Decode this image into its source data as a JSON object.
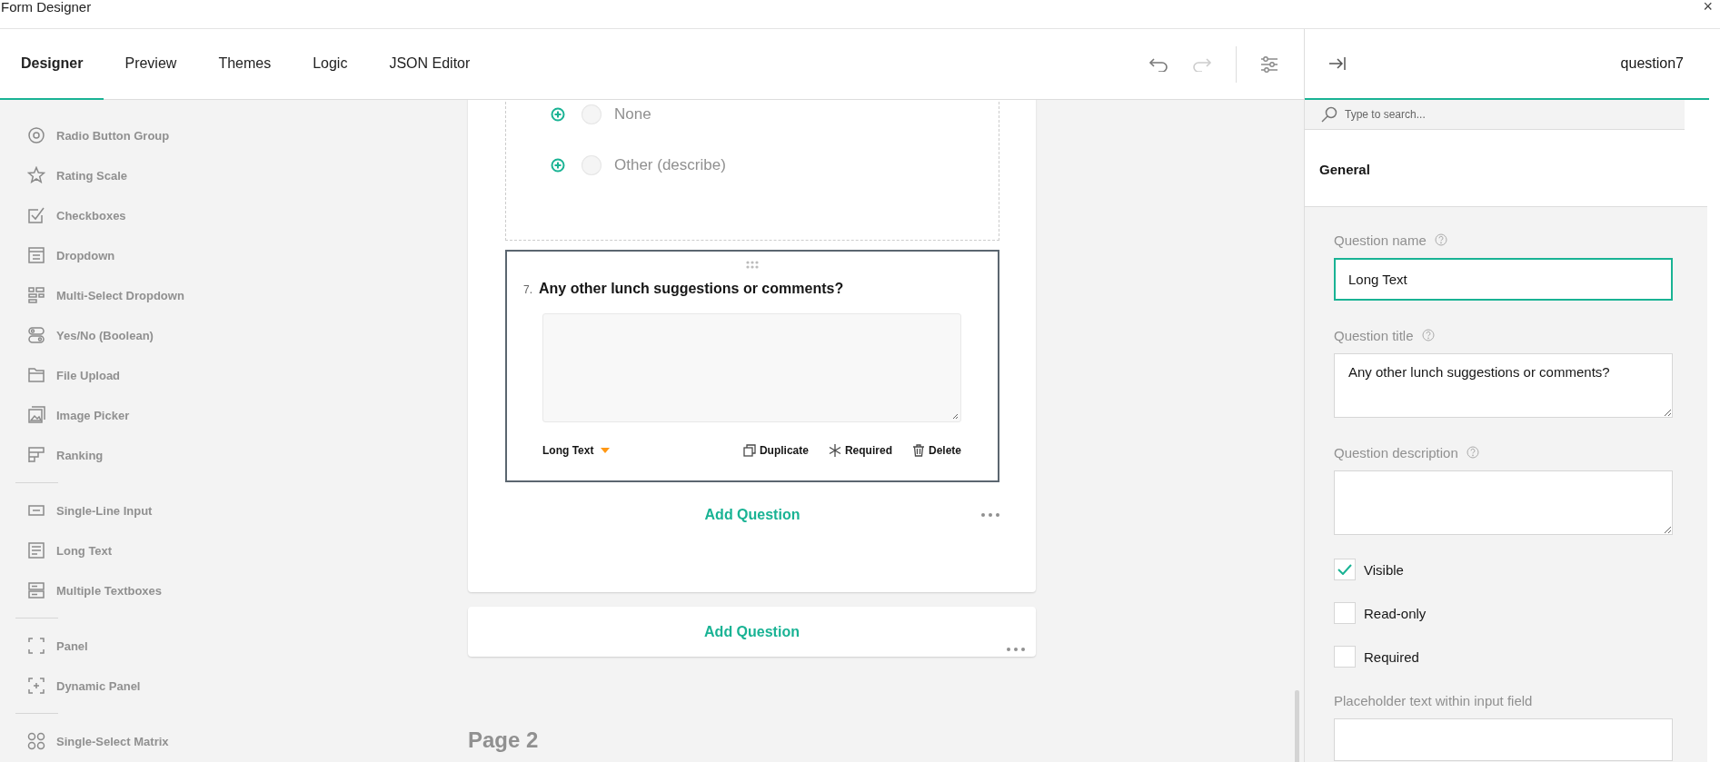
{
  "window": {
    "title": "Form Designer",
    "close": "×"
  },
  "tabs": [
    {
      "label": "Designer",
      "selected": true
    },
    {
      "label": "Preview",
      "selected": false
    },
    {
      "label": "Themes",
      "selected": false
    },
    {
      "label": "Logic",
      "selected": false
    },
    {
      "label": "JSON Editor",
      "selected": false
    }
  ],
  "history": [
    {
      "kind": "undo",
      "disabled": false
    },
    {
      "kind": "redo",
      "disabled": true
    }
  ],
  "toolbox": [
    [
      {
        "kind": "radio",
        "label": "Radio Button Group"
      },
      {
        "kind": "rating",
        "label": "Rating Scale"
      },
      {
        "kind": "checkbox",
        "label": "Checkboxes"
      },
      {
        "kind": "dropdown",
        "label": "Dropdown"
      },
      {
        "kind": "tagbox",
        "label": "Multi-Select Dropdown"
      },
      {
        "kind": "boolean",
        "label": "Yes/No (Boolean)"
      },
      {
        "kind": "file",
        "label": "File Upload"
      },
      {
        "kind": "image",
        "label": "Image Picker"
      },
      {
        "kind": "ranking",
        "label": "Ranking"
      }
    ],
    [
      {
        "kind": "text",
        "label": "Single-Line Input"
      },
      {
        "kind": "comment",
        "label": "Long Text"
      },
      {
        "kind": "multipletext",
        "label": "Multiple Textboxes"
      }
    ],
    [
      {
        "kind": "panel",
        "label": "Panel"
      },
      {
        "kind": "paneldynamic",
        "label": "Dynamic Panel"
      }
    ],
    [
      {
        "kind": "matrix",
        "label": "Single-Select Matrix"
      }
    ]
  ],
  "canvas": {
    "choices": [
      {
        "label": "None",
        "selected": false
      },
      {
        "label": "Other (describe)",
        "selected": false
      }
    ],
    "question": {
      "number": "7.",
      "title": "Any other lunch suggestions or comments?",
      "type": "Long Text",
      "actions": [
        {
          "kind": "duplicate",
          "label": "Duplicate"
        },
        {
          "kind": "required",
          "label": "Required"
        },
        {
          "kind": "delete",
          "label": "Delete"
        }
      ]
    },
    "add_question": "Add Question",
    "page_add_question": "Add Question",
    "next_page": "Page 2"
  },
  "property_panel": {
    "title": "question7",
    "search": {
      "placeholder": "Type to search..."
    },
    "section": "General",
    "properties": [
      {
        "kind": "input",
        "label": "Question name",
        "help": true,
        "value": "Long Text",
        "focused": true
      },
      {
        "kind": "textarea",
        "label": "Question title",
        "help": true,
        "value": "Any other lunch suggestions or comments?"
      },
      {
        "kind": "textarea",
        "label": "Question description",
        "help": true
      },
      {
        "kind": "checkbox",
        "label": "Visible",
        "checked": true
      },
      {
        "kind": "checkbox",
        "label": "Read-only",
        "checked": false
      },
      {
        "kind": "checkbox",
        "label": "Required",
        "checked": false
      },
      {
        "kind": "input",
        "label": "Placeholder text within input field",
        "help": false,
        "focused": false
      }
    ]
  }
}
